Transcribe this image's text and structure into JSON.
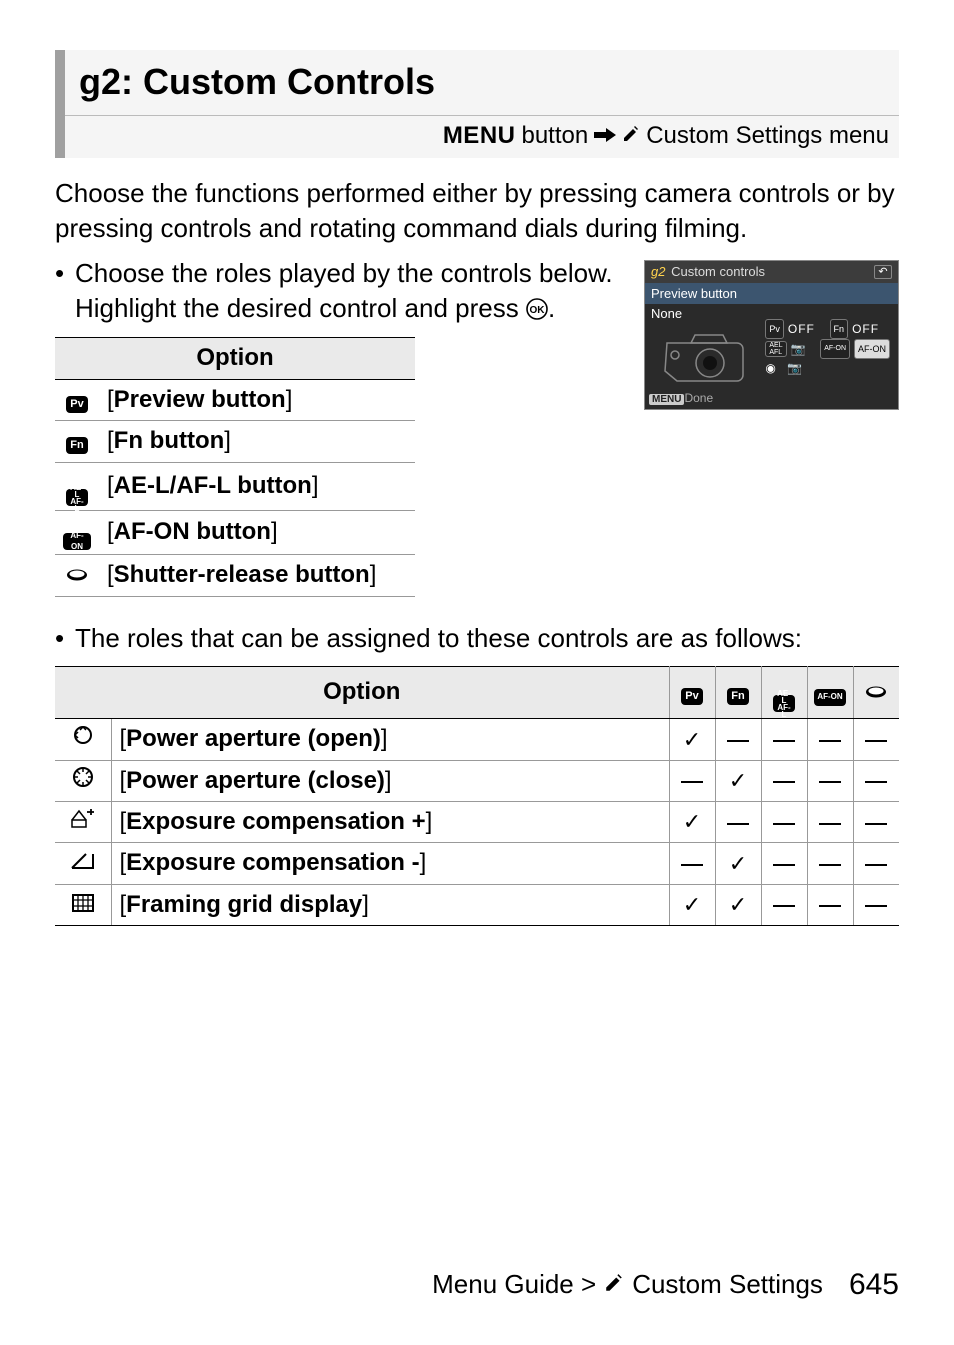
{
  "header": {
    "title": "g2: Custom Controls",
    "menu_label": "MENU",
    "button_text": "button",
    "breadcrumb": "Custom Settings menu"
  },
  "intro": "Choose the functions performed either by pressing camera controls or by pressing controls and rotating command dials during filming.",
  "bullet1": {
    "text_before": "Choose the roles played by the controls below. Highlight the desired control and press ",
    "text_after": "."
  },
  "screenshot": {
    "title_prefix": "g2",
    "title": "Custom controls",
    "line1": "Preview button",
    "line2": "None",
    "tag_pv": "Pv",
    "tag_off1": "OFF",
    "tag_fn": "Fn",
    "tag_off2": "OFF",
    "tag_afon": "AF-ON",
    "done": "Done"
  },
  "table1": {
    "header": "Option",
    "rows": [
      {
        "label": "Preview button"
      },
      {
        "label": "Fn button"
      },
      {
        "label": "AE-L/AF-L button"
      },
      {
        "label": "AF-ON button"
      },
      {
        "label": "Shutter-release button"
      }
    ]
  },
  "bullet2": "The roles that can be assigned to these controls are as follows:",
  "table2": {
    "header_option": "Option",
    "rows": [
      {
        "label": "Power aperture (open)",
        "c": [
          "y",
          "n",
          "n",
          "n",
          "n"
        ]
      },
      {
        "label": "Power aperture (close)",
        "c": [
          "n",
          "y",
          "n",
          "n",
          "n"
        ]
      },
      {
        "label": "Exposure compensation +",
        "c": [
          "y",
          "n",
          "n",
          "n",
          "n"
        ]
      },
      {
        "label": "Exposure compensation -",
        "c": [
          "n",
          "y",
          "n",
          "n",
          "n"
        ]
      },
      {
        "label": "Framing grid display",
        "c": [
          "y",
          "y",
          "n",
          "n",
          "n"
        ]
      }
    ]
  },
  "footer": {
    "path_prefix": "Menu Guide >",
    "path_section": "Custom Settings",
    "page": "645"
  }
}
